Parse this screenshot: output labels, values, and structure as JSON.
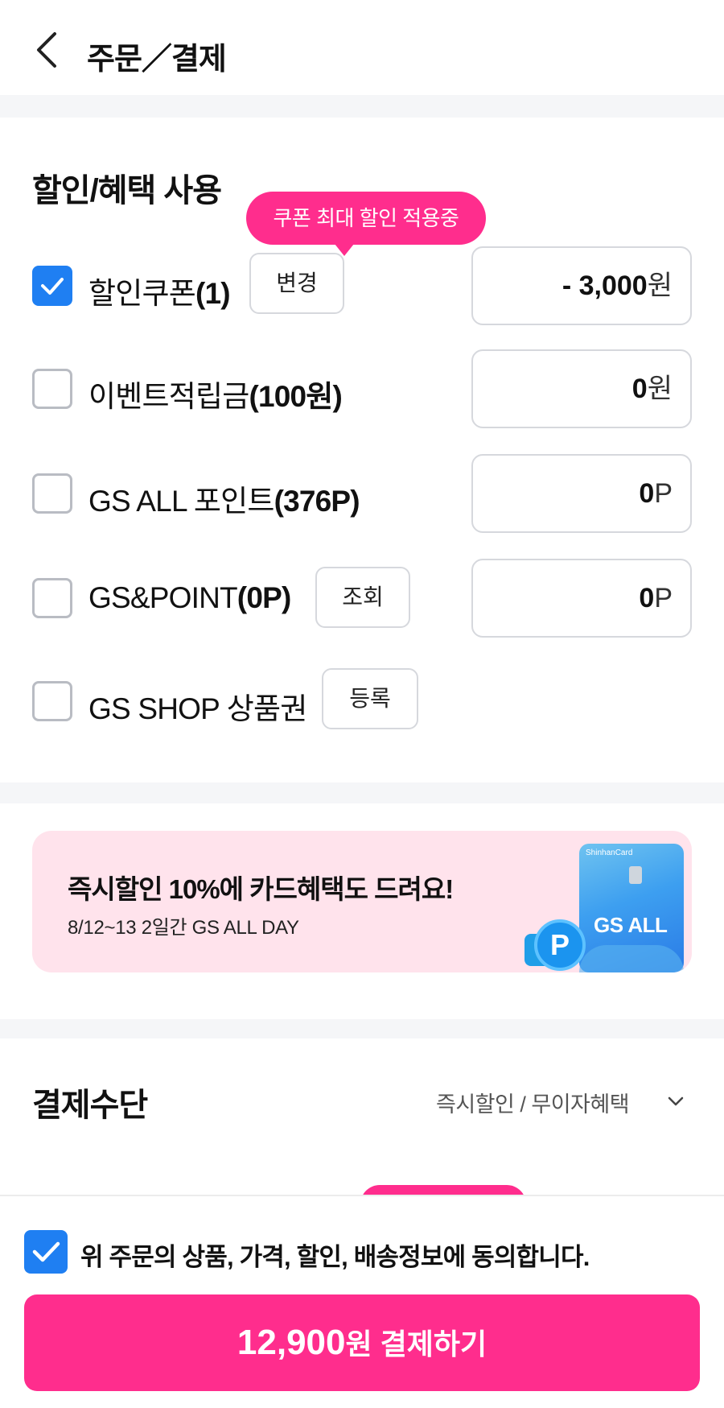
{
  "header": {
    "title": "주문／결제"
  },
  "discount": {
    "title": "할인/혜택 사용",
    "tooltip": "쿠폰 최대 할인 적용중",
    "rows": [
      {
        "label": "할인쿠폰",
        "count": "(1)",
        "checked": true,
        "button": "변경",
        "amount": "- 3,000",
        "unit": "원"
      },
      {
        "label": "이벤트적립금",
        "count": "(100원)",
        "checked": false,
        "amount": "0",
        "unit": "원"
      },
      {
        "label": "GS ALL 포인트",
        "count": "(376P)",
        "checked": false,
        "amount": "0",
        "unit": "P"
      },
      {
        "label": "GS&POINT",
        "count": "(0P)",
        "checked": false,
        "button": "조회",
        "amount": "0",
        "unit": "P"
      },
      {
        "label": "GS SHOP 상품권",
        "count": "",
        "checked": false,
        "button": "등록"
      }
    ]
  },
  "banner": {
    "title": "즉시할인 10%에 카드혜택도 드려요!",
    "subtitle": "8/12~13 2일간 GS ALL DAY",
    "card_brand": "ShinhanCard",
    "card_logo": "GS ALL",
    "coin_letter": "P",
    "bg_color": "#ffe3ec"
  },
  "payment": {
    "title": "결제수단",
    "link": "즉시할인 / 무이자혜택"
  },
  "footer": {
    "agree_text": "위 주문의 상품, 가격, 할인, 배송정보에 동의합니다.",
    "agree_checked": true,
    "pay_amount": "12,900",
    "pay_rest": "원 결제하기"
  },
  "colors": {
    "accent": "#ff2d8d",
    "checkbox": "#1f7ff2"
  },
  "icons": {
    "back": "chevron-left-icon",
    "check": "check-icon",
    "dropdown": "chevron-down-icon"
  }
}
